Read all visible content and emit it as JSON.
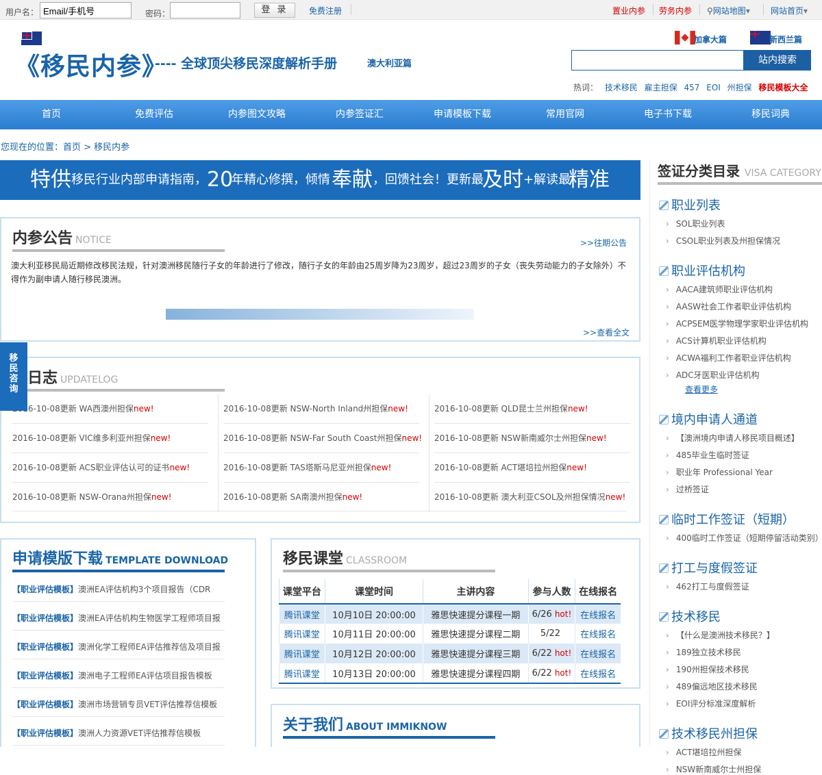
{
  "login": {
    "user_label": "用户名：",
    "user_value": "Email/手机号",
    "pwd_label": "密码：",
    "pwd_value": "",
    "login_btn": "登 录",
    "register": "免费注册"
  },
  "toplinks": {
    "zhiye": "置业内参",
    "laowu": "劳务内参",
    "sitemap": "网站地图",
    "home": "网站首页"
  },
  "header": {
    "logo": "《移民内参》",
    "slogan": "---- 全球顶尖移民深度解析手册",
    "aus": "澳大利亚篇",
    "canada": "加拿大篇",
    "nz": "新西兰篇",
    "search_btn": "站内搜索",
    "hot_label": "热词：",
    "hot": [
      "技术移民",
      "雇主担保",
      "457",
      "EOI",
      "州担保"
    ],
    "hot_red": "移民模板大全"
  },
  "nav": [
    "首页",
    "免费评估",
    "内参图文攻略",
    "内参签证汇",
    "申请模板下载",
    "常用官网",
    "电子书下载",
    "移民词典"
  ],
  "breadcrumb": "您现在的位置：首页 > 移民内参",
  "banner": {
    "p1": "特供",
    "p2": "移民行业内部申请指南，",
    "p3": "20",
    "p4": "年精心修撰，倾情",
    "p5": "奉献",
    "p6": "，回馈社会！更新最",
    "p7": "及时",
    "p8": "+解读最",
    "p9": "精准"
  },
  "notice": {
    "title": "内参公告",
    "en": "NOTICE",
    "past": ">>往期公告",
    "text": "澳大利亚移民局近期修改移民法规，针对澳洲移民随行子女的年龄进行了修改，随行子女的年龄由25周岁降为23周岁，超过23周岁的子女（丧失劳动能力的子女除外）不得作为副申请人随行移民澳洲。",
    "full": ">>查看全文",
    "progress": 0.5
  },
  "float_btn": "移民咨询",
  "updatelog": {
    "title": "更新日志",
    "title_visible": "新日志",
    "en": "UPDATELOG",
    "new": "new!",
    "items": [
      [
        "2016-10-08更新 WA西澳州担保",
        "2016-10-08更新 NSW-North Inland州担保",
        "2016-10-08更新 QLD昆士兰州担保"
      ],
      [
        "2016-10-08更新 VIC维多利亚州担保",
        "2016-10-08更新 NSW-Far South Coast州担保",
        "2016-10-08更新 NSW新南威尔士州担保"
      ],
      [
        "2016-10-08更新 ACS职业评估认可的证书",
        "2016-10-08更新 TAS塔斯马尼亚州担保",
        "2016-10-08更新 ACT堪培拉州担保"
      ],
      [
        "2016-10-08更新 NSW-Orana州担保",
        "2016-10-08更新 SA南澳州担保",
        "2016-10-08更新 澳大利亚CSOL及州担保情况"
      ]
    ]
  },
  "template": {
    "title": "申请模版下载",
    "en": "TEMPLATE DOWNLOAD",
    "tag": "【职业评估模板】",
    "items": [
      "澳洲EA评估机构3个项目报告（CDR",
      "澳洲EA评估机构生物医学工程师项目报",
      "澳洲化学工程师EA评估推荐信及项目报",
      "澳洲电子工程师EA评估项目报告模板",
      "澳洲市场营销专员VET评估推荐信模板",
      "澳洲人力资源VET评估推荐信模板"
    ]
  },
  "classroom": {
    "title": "移民课堂",
    "en": "CLASSROOM",
    "headers": [
      "课堂平台",
      "课堂时间",
      "主讲内容",
      "参与人数",
      "在线报名"
    ],
    "rows": [
      {
        "platform": "腾讯课堂",
        "time": "10月10日  20:00:00",
        "topic": "雅思快速提分课程一期",
        "count": "6/26",
        "hot": "hot!",
        "signup": "在线报名"
      },
      {
        "platform": "腾讯课堂",
        "time": "10月11日  20:00:00",
        "topic": "雅思快速提分课程二期",
        "count": "5/22",
        "hot": "",
        "signup": "在线报名"
      },
      {
        "platform": "腾讯课堂",
        "time": "10月12日  20:00:00",
        "topic": "雅思快速提分课程三期",
        "count": "6/22",
        "hot": "hot!",
        "signup": "在线报名"
      },
      {
        "platform": "腾讯课堂",
        "time": "10月13日  20:00:00",
        "topic": "雅思快速提分课程四期",
        "count": "6/22",
        "hot": "hot!",
        "signup": "在线报名"
      }
    ]
  },
  "about": {
    "title": "关于我们",
    "en": "ABOUT IMMIKNOW"
  },
  "sidebar": {
    "title": "签证分类目录",
    "en": "VISA CATEGORY",
    "cats": [
      {
        "name": "职业列表",
        "subs": [
          "SOL职业列表",
          "CSOL职业列表及州担保情况"
        ]
      },
      {
        "name": "职业评估机构",
        "subs": [
          "AACA建筑师职业评估机构",
          "AASW社会工作者职业评估机构",
          "ACPSEM医学物理学家职业评估机构",
          "ACS计算机职业评估机构",
          "ACWA福利工作者职业评估机构",
          "ADC牙医职业评估机构"
        ],
        "more": "查看更多"
      },
      {
        "name": "境内申请人通道",
        "subs": [
          "【澳洲境内申请人移民项目概述】",
          "485毕业生临时签证",
          "职业年 Professional Year",
          "过桥签证"
        ]
      },
      {
        "name": "临时工作签证（短期）",
        "subs": [
          "400临时工作签证（短期停留活动类别）"
        ]
      },
      {
        "name": "打工与度假签证",
        "subs": [
          "462打工与度假签证"
        ]
      },
      {
        "name": "技术移民",
        "subs": [
          "【什么是澳洲技术移民？】",
          "189独立技术移民",
          "190州担保技术移民",
          "489偏远地区技术移民",
          "EOI评分标准深度解析"
        ]
      },
      {
        "name": "技术移民州担保",
        "subs": [
          "ACT堪培拉州担保",
          "NSW新南威尔士州担保"
        ]
      }
    ]
  },
  "colors": {
    "brand": "#1a64a8",
    "nav": "#3d8ddb",
    "red": "#d40000"
  }
}
